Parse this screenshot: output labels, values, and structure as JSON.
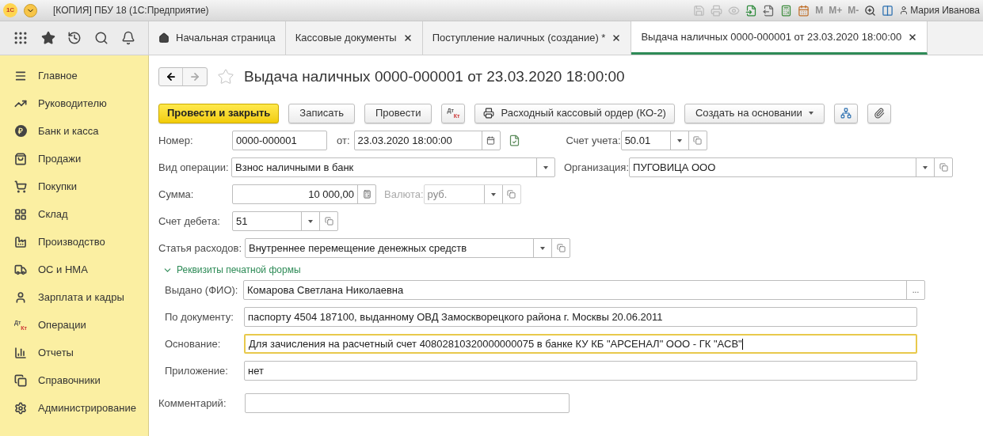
{
  "window": {
    "logo": "1С",
    "title": "[КОПИЯ] ПБУ 18  (1С:Предприятие)",
    "memory_buttons": [
      {
        "label": "M",
        "disabled": true
      },
      {
        "label": "M+",
        "disabled": true
      },
      {
        "label": "M-",
        "disabled": true
      }
    ],
    "user": "Мария Иванова"
  },
  "tabs": [
    {
      "label": "Начальная страница",
      "kind": "home",
      "selected": false
    },
    {
      "label": "Кассовые документы",
      "kind": "closable",
      "selected": false
    },
    {
      "label": "Поступление наличных (создание) *",
      "kind": "closable",
      "selected": false
    },
    {
      "label": "Выдача наличных 0000-000001 от 23.03.2020 18:00:00",
      "kind": "closable",
      "selected": true
    }
  ],
  "sidebar": {
    "items": [
      {
        "label": "Главное"
      },
      {
        "label": "Руководителю"
      },
      {
        "label": "Банк и касса",
        "icon_glyph": "₽"
      },
      {
        "label": "Продажи"
      },
      {
        "label": "Покупки"
      },
      {
        "label": "Склад"
      },
      {
        "label": "Производство"
      },
      {
        "label": "ОС и НМА"
      },
      {
        "label": "Зарплата и кадры"
      },
      {
        "label": "Операции",
        "icon_text": [
          "Дт",
          "Кт"
        ]
      },
      {
        "label": "Отчеты"
      },
      {
        "label": "Справочники"
      },
      {
        "label": "Администрирование"
      }
    ]
  },
  "document": {
    "title": "Выдача наличных 0000-000001 от 23.03.2020 18:00:00",
    "favorite": false,
    "buttons": [
      {
        "kind": "primary",
        "label": "Провести и закрыть"
      },
      {
        "kind": "default",
        "label": "Записать"
      },
      {
        "kind": "default",
        "label": "Провести"
      },
      {
        "kind": "dtkt",
        "icon_text": [
          "Дт",
          "Кт"
        ]
      },
      {
        "kind": "print",
        "label": "Расходный кассовый ордер (КО-2)"
      },
      {
        "kind": "menu",
        "label": "Создать на основании"
      },
      {
        "kind": "structure"
      },
      {
        "kind": "attach"
      }
    ],
    "form": {
      "number": {
        "label": "Номер:",
        "value": "0000-000001"
      },
      "date": {
        "label": "от:",
        "value": "23.03.2020 18:00:00"
      },
      "account": {
        "label": "Счет учета:",
        "value": "50.01"
      },
      "operation": {
        "label": "Вид операции:",
        "value": "Взнос наличными в банк"
      },
      "organization": {
        "label": "Организация:",
        "value": "ПУГОВИЦА ООО"
      },
      "amount": {
        "label": "Сумма:",
        "value": "10 000,00"
      },
      "currency": {
        "label": "Валюта:",
        "value": "руб.",
        "disabled": true
      },
      "debit_account": {
        "label": "Счет дебета:",
        "value": "51"
      },
      "expense_item": {
        "label": "Статья расходов:",
        "value": "Внутреннее перемещение денежных средств"
      },
      "print_group": {
        "title": "Реквизиты печатной формы",
        "expanded": true,
        "fields": [
          {
            "label": "Выдано (ФИО):",
            "value": "Комарова Светлана Николаевна",
            "focused": false,
            "kind": "choice",
            "button_text": "..."
          },
          {
            "label": "По документу:",
            "value": "паспорту 4504 187100, выданному ОВД Замоскворецкого района г. Москвы 20.06.2011",
            "focused": false,
            "kind": "text"
          },
          {
            "label": "Основание:",
            "value": "Для зачисления на расчетный счет 40802810320000000075 в банке КУ КБ \"АРСЕНАЛ\" ООО - ГК \"АСВ\"",
            "focused": true,
            "kind": "text"
          },
          {
            "label": "Приложение:",
            "value": "нет",
            "focused": false,
            "kind": "text"
          }
        ]
      },
      "comment": {
        "label": "Комментарий:"
      }
    }
  }
}
